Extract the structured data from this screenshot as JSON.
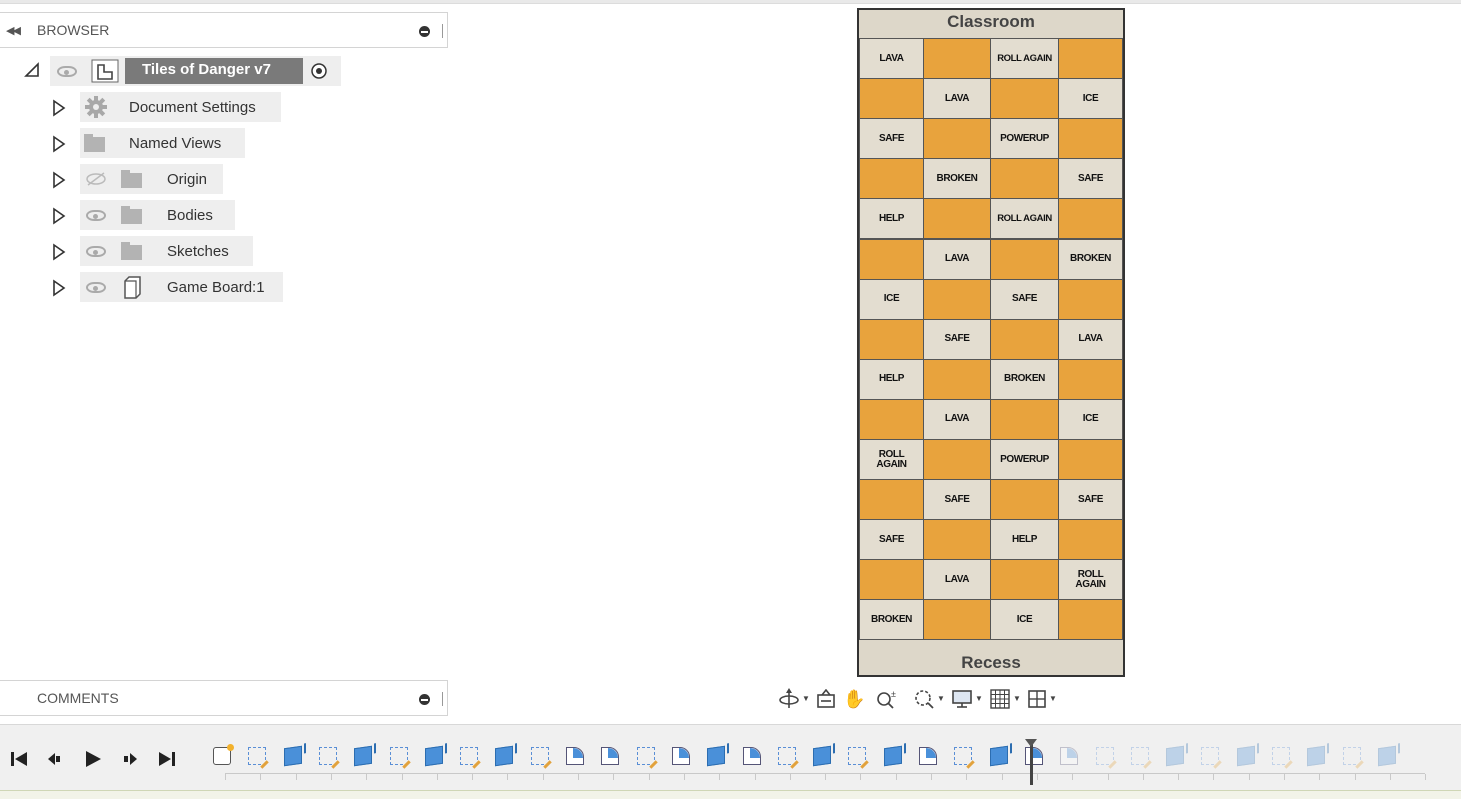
{
  "browser": {
    "title": "BROWSER",
    "root_label": "Tiles of Danger v7",
    "items": [
      {
        "label": "Document Settings",
        "icon": "gear-icon",
        "eye": "none"
      },
      {
        "label": "Named Views",
        "icon": "folder-icon",
        "eye": "none"
      },
      {
        "label": "Origin",
        "icon": "folder-icon",
        "eye": "hidden"
      },
      {
        "label": "Bodies",
        "icon": "folder-icon",
        "eye": "visible"
      },
      {
        "label": "Sketches",
        "icon": "folder-icon",
        "eye": "visible"
      },
      {
        "label": "Game Board:1",
        "icon": "component-icon",
        "eye": "visible"
      }
    ]
  },
  "comments": {
    "title": "COMMENTS"
  },
  "board": {
    "top_label": "Classroom",
    "bottom_label": "Recess",
    "rows": [
      [
        "LAVA",
        "",
        "ROLL AGAIN",
        ""
      ],
      [
        "",
        "LAVA",
        "",
        "ICE"
      ],
      [
        "SAFE",
        "",
        "POWERUP",
        ""
      ],
      [
        "",
        "BROKEN",
        "",
        "SAFE"
      ],
      [
        "HELP",
        "",
        "ROLL AGAIN",
        ""
      ],
      [
        "",
        "LAVA",
        "",
        "BROKEN"
      ],
      [
        "ICE",
        "",
        "SAFE",
        ""
      ],
      [
        "",
        "SAFE",
        "",
        "LAVA"
      ],
      [
        "HELP",
        "",
        "BROKEN",
        ""
      ],
      [
        "",
        "LAVA",
        "",
        "ICE"
      ],
      [
        "ROLL AGAIN",
        "",
        "POWERUP",
        ""
      ],
      [
        "",
        "SAFE",
        "",
        "SAFE"
      ],
      [
        "SAFE",
        "",
        "HELP",
        ""
      ],
      [
        "",
        "LAVA",
        "",
        "ROLL AGAIN"
      ],
      [
        "BROKEN",
        "",
        "ICE",
        ""
      ]
    ],
    "colors": {
      "orange": "#e8a33d",
      "beige": "#e3ddd0"
    }
  },
  "nav_toolbar": {
    "icons": [
      "orbit-icon",
      "look-at-icon",
      "pan-icon",
      "zoom-icon",
      "fit-icon",
      "display-settings-icon",
      "grid-icon",
      "viewports-icon"
    ]
  },
  "timeline": {
    "controls": [
      "go-to-start-icon",
      "step-back-icon",
      "play-icon",
      "step-forward-icon",
      "go-to-end-icon"
    ],
    "features": [
      "start",
      "sketch",
      "extrude",
      "sketch",
      "extrude",
      "sketch",
      "extrude",
      "sketch",
      "extrude",
      "sketch",
      "fillet",
      "fillet",
      "sketch",
      "fillet",
      "extrude",
      "fillet",
      "sketch",
      "extrude",
      "sketch",
      "extrude",
      "fillet",
      "sketch",
      "extrude",
      "fillet",
      "fillet",
      "sketch",
      "sketch",
      "extrude",
      "sketch",
      "extrude",
      "sketch",
      "extrude",
      "sketch",
      "extrude"
    ],
    "active_count": 24
  }
}
